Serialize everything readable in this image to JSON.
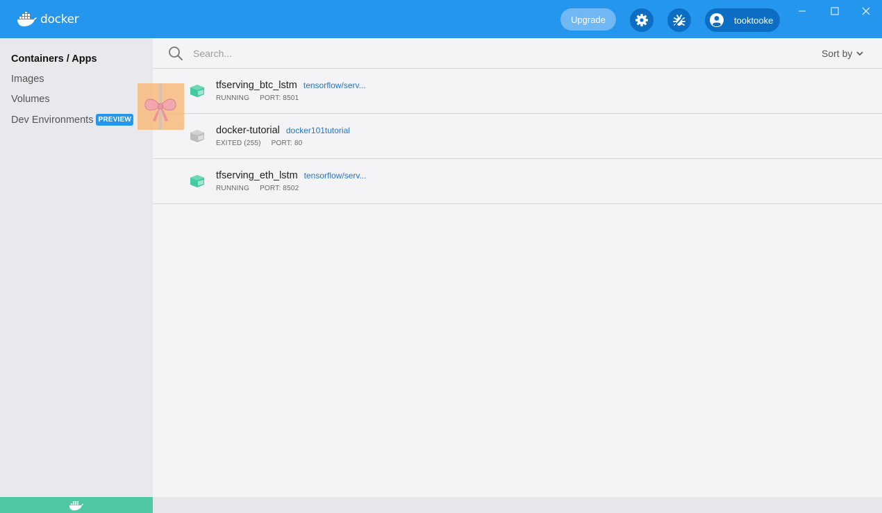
{
  "header": {
    "logo_text": "docker",
    "upgrade_label": "Upgrade",
    "username": "tooktooke",
    "colors": {
      "topbar": "#2496ed",
      "button_dark": "#0b6ec2"
    }
  },
  "sidebar": {
    "items": [
      {
        "label": "Containers / Apps",
        "active": true
      },
      {
        "label": "Images",
        "active": false
      },
      {
        "label": "Volumes",
        "active": false
      },
      {
        "label": "Dev Environments",
        "active": false,
        "badge": "PREVIEW"
      }
    ]
  },
  "search": {
    "placeholder": "Search...",
    "value": ""
  },
  "sort": {
    "label": "Sort by"
  },
  "containers": [
    {
      "name": "tfserving_btc_lstm",
      "image": "tensorflow/serv...",
      "status": "RUNNING",
      "port": "PORT: 8501",
      "state_color": "#44c9a2"
    },
    {
      "name": "docker-tutorial",
      "image": "docker101tutorial",
      "status": "EXITED (255)",
      "port": "PORT: 80",
      "state_color": "#bcbcbc"
    },
    {
      "name": "tfserving_eth_lstm",
      "image": "tensorflow/serv...",
      "status": "RUNNING",
      "port": "PORT: 8502",
      "state_color": "#44c9a2"
    }
  ]
}
